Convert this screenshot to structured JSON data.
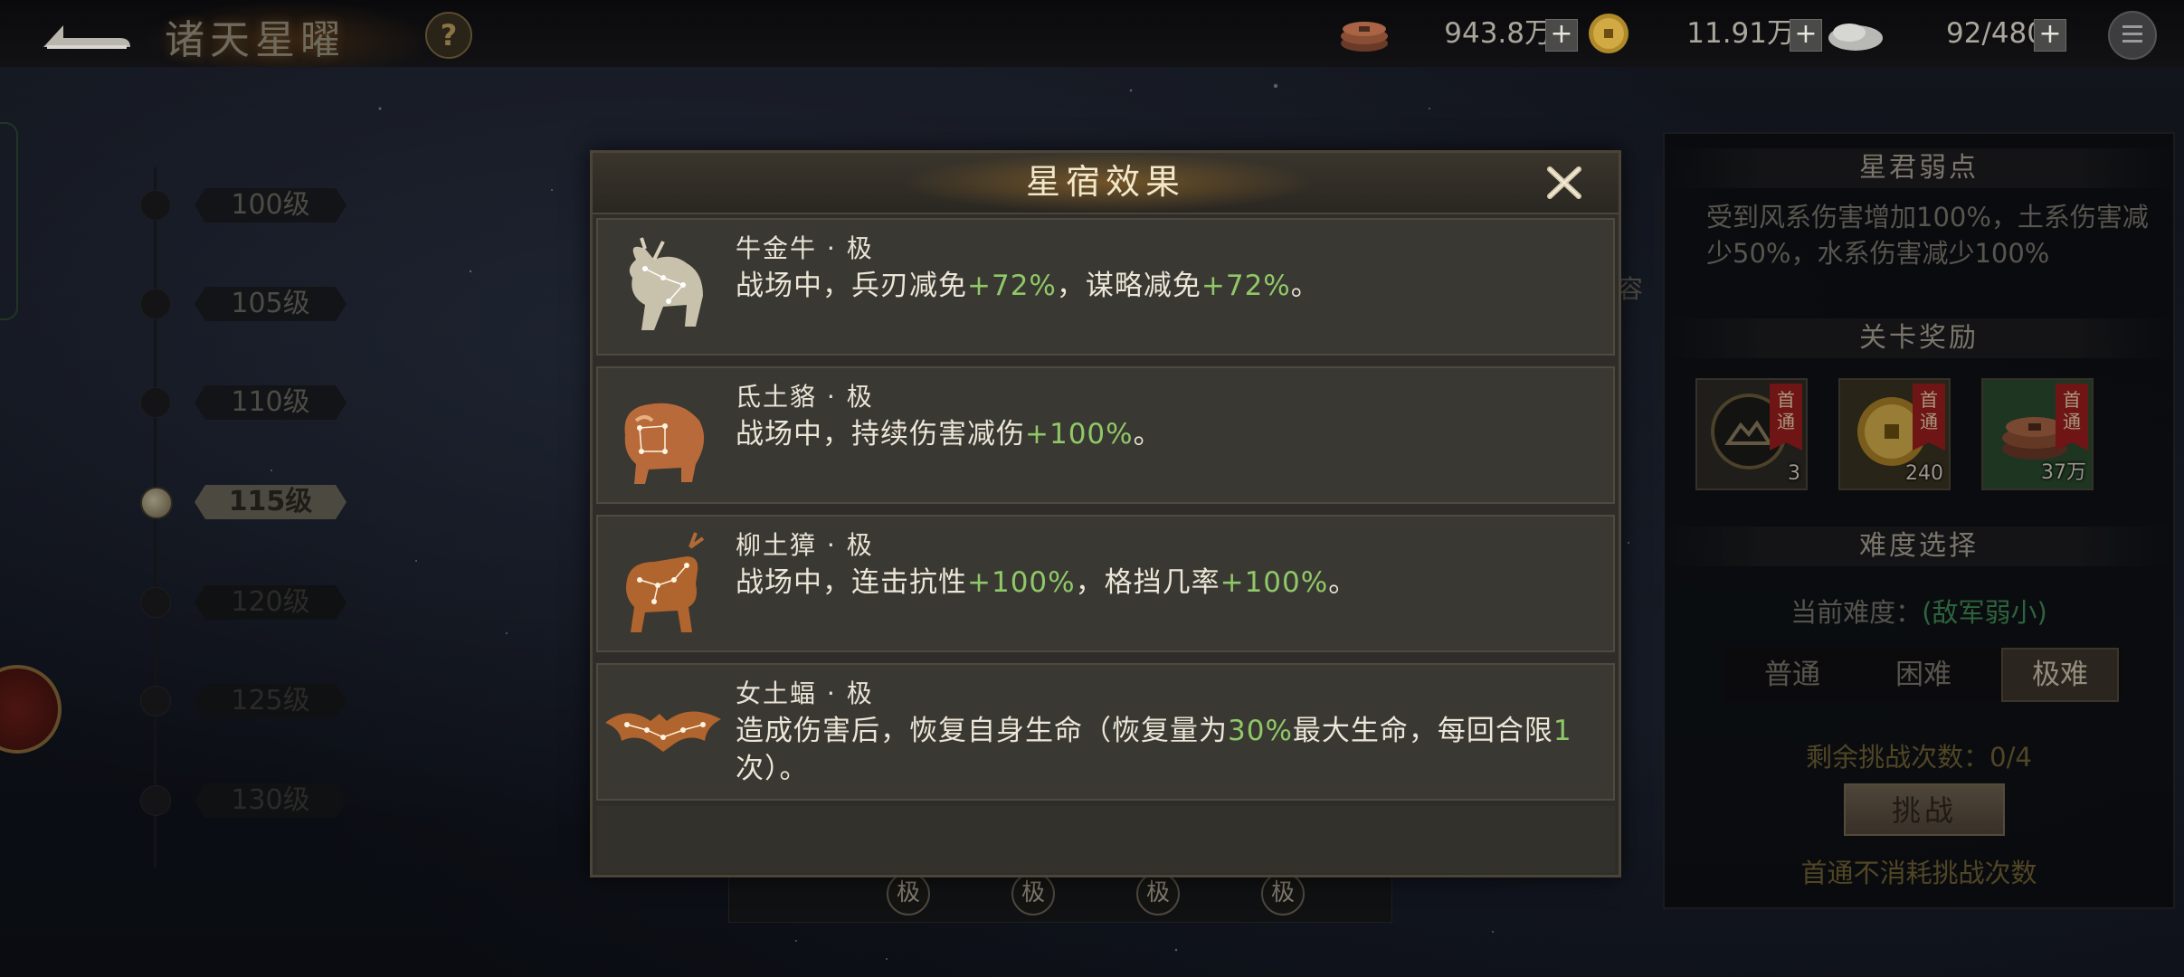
{
  "header": {
    "title": "诸天星曜",
    "help": "?",
    "resources": [
      {
        "name": "copper-coins",
        "value": "943.8万"
      },
      {
        "name": "gold-coin",
        "value": "11.91万"
      },
      {
        "name": "stamina",
        "value": "92/480"
      }
    ],
    "plus": "+"
  },
  "levels": [
    {
      "label": "100级",
      "state": "normal"
    },
    {
      "label": "105级",
      "state": "normal"
    },
    {
      "label": "110级",
      "state": "normal"
    },
    {
      "label": "115级",
      "state": "active"
    },
    {
      "label": "120级",
      "state": "dim"
    },
    {
      "label": "125级",
      "state": "dim"
    },
    {
      "label": "130级",
      "state": "dim"
    }
  ],
  "modal": {
    "title": "星宿效果",
    "effects": [
      {
        "icon": "ox-constellation-icon",
        "name": "牛金牛 · 极",
        "desc": [
          "战场中，兵刃减免",
          "+72%",
          "，谋略减免",
          "+72%",
          "。"
        ]
      },
      {
        "icon": "badger-constellation-icon",
        "name": "氐土貉 · 极",
        "desc": [
          "战场中，持续伤害减伤",
          "+100%",
          "。"
        ]
      },
      {
        "icon": "deer-constellation-icon",
        "name": "柳土獐 · 极",
        "desc": [
          "战场中，连击抗性",
          "+100%",
          "，格挡几率",
          "+100%",
          "。"
        ]
      },
      {
        "icon": "bat-constellation-icon",
        "name": "女土蝠 · 极",
        "desc": [
          "造成伤害后，恢复自身生命（恢复量为",
          "30%",
          "最大生命，每回合限",
          "1",
          "次）。"
        ]
      }
    ]
  },
  "background": {
    "ji_label": "极",
    "side_text": "容"
  },
  "right_panel": {
    "weakness_title": "星君弱点",
    "weakness_text": "受到风系伤害增加100%，土系伤害减少50%，水系伤害减少100%",
    "reward_title": "关卡奖励",
    "rewards": [
      {
        "icon": "mountain-token-icon",
        "ribbon": "首通",
        "count": "3"
      },
      {
        "icon": "gold-coin-icon",
        "ribbon": "首通",
        "count": "240"
      },
      {
        "icon": "copper-coins-icon",
        "ribbon": "首通",
        "count": "37万"
      }
    ],
    "difficulty_title": "难度选择",
    "current_label": "当前难度：",
    "current_value": "(敌军弱小)",
    "difficulties": [
      "普通",
      "困难",
      "极难"
    ],
    "selected_difficulty": "极难",
    "remaining": "剩余挑战次数：0/4",
    "challenge": "挑战",
    "free_note": "首通不消耗挑战次数"
  }
}
